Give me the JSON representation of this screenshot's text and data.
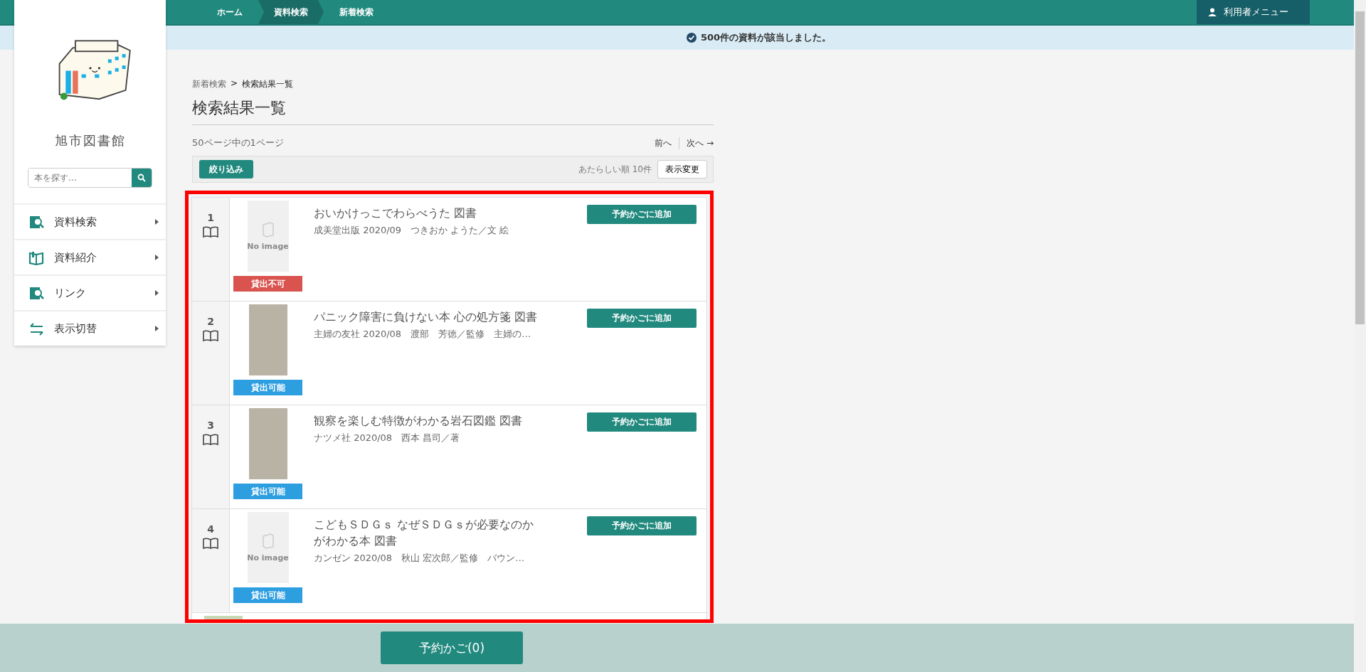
{
  "top_nav": {
    "breadcrumbs": [
      {
        "label": "ホーム",
        "selected": false
      },
      {
        "label": "資料検索",
        "selected": true
      },
      {
        "label": "新着検索",
        "selected": false
      }
    ],
    "user_menu": "利用者メニュー"
  },
  "notice": "500件の資料が該当しました。",
  "sidebar": {
    "library_name": "旭市図書館",
    "search": {
      "placeholder": "本を探す…"
    },
    "items": [
      {
        "label": "資料検索",
        "kind": "search"
      },
      {
        "label": "資料紹介",
        "kind": "book"
      },
      {
        "label": "リンク",
        "kind": "search"
      },
      {
        "label": "表示切替",
        "kind": "switch"
      }
    ]
  },
  "breadcrumb": {
    "items": [
      "新着検索",
      "検索結果一覧"
    ],
    "separator": ">"
  },
  "title": "検索結果一覧",
  "page_info": "50ページ中の1ページ",
  "pager": {
    "prev": "前へ",
    "next": "次へ →"
  },
  "toolbar": {
    "filter_button": "絞り込み",
    "sort_info": "あたらしい順 10件",
    "display_button": "表示変更"
  },
  "results": [
    {
      "number": "1",
      "title": "おいかけっこでわらべうた 図書",
      "meta": "成美堂出版 2020/09　つきおか ようた／文 絵",
      "cover": {
        "kind": "no-image",
        "text": "No image"
      },
      "availability": "貸出不可",
      "available": false,
      "add_button": "予約かごに追加"
    },
    {
      "number": "2",
      "title": "パニック障害に負けない本 心の処方箋 図書",
      "meta": "主婦の友社 2020/08　渡部　芳徳／監修　主婦の…",
      "cover": {
        "kind": "photo"
      },
      "availability": "貸出可能",
      "available": true,
      "add_button": "予約かごに追加"
    },
    {
      "number": "3",
      "title": "観察を楽しむ特徴がわかる岩石図鑑 図書",
      "meta": "ナツメ社 2020/08　西本 昌司／著",
      "cover": {
        "kind": "photo"
      },
      "availability": "貸出可能",
      "available": true,
      "add_button": "予約かごに追加"
    },
    {
      "number": "4",
      "title": "こどもＳＤＧｓ なぜＳＤＧｓが必要なのかがわかる本 図書",
      "meta": "カンゼン 2020/08　秋山 宏次郎／監修　バウン…",
      "cover": {
        "kind": "no-image",
        "text": "No image"
      },
      "availability": "貸出可能",
      "available": true,
      "add_button": "予約かごに追加"
    }
  ],
  "cart_button": "予約かご(0)"
}
